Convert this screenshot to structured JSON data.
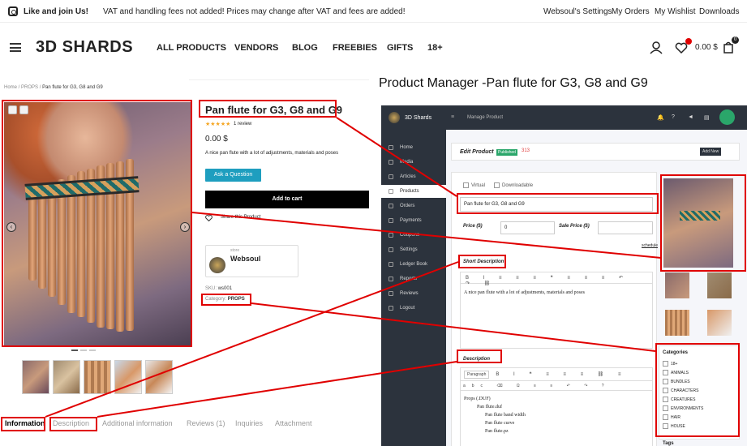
{
  "topbar": {
    "like": "Like and join Us!",
    "vat": "VAT and handling fees not added! Prices may change after VAT and fees are added!",
    "links": [
      "Websoul's Settings",
      "My Orders",
      "My Wishlist",
      "Downloads"
    ]
  },
  "nav": {
    "logo": "3D SHARDS",
    "items": [
      "ALL PRODUCTS",
      "VENDORS",
      "BLOG",
      "FREEBIES",
      "GIFTS",
      "18+"
    ],
    "cart_total": "0.00 $",
    "cart_count": "0"
  },
  "breadcrumb": {
    "home": "Home",
    "cat": "PROPS",
    "current": "Pan flute for G3, G8 and G9"
  },
  "product": {
    "title": "Pan flute for G3, G8 and G9",
    "stars": "★★★★★",
    "reviews": "1 review",
    "price": "0.00 $",
    "short_desc": "A nice pan flute with a lot of adjustments, materials and poses",
    "ask_btn": "Ask a Question",
    "cart_btn": "Add to cart",
    "share": "Share this Product",
    "store_label": "store",
    "store_name": "Websoul",
    "sku_label": "SKU:",
    "sku": "ws001",
    "cat_label": "Category:",
    "cat": "PROPS"
  },
  "tabs": [
    "Information",
    "Description",
    "Additional information",
    "Reviews (1)",
    "Inquiries",
    "Attachment"
  ],
  "manager_title": "Product Manager -Pan flute for G3, G8 and G9",
  "admin": {
    "brand": "3D Shards",
    "crumb": "Manage Product",
    "menu": [
      "Home",
      "Media",
      "Articles",
      "Products",
      "Orders",
      "Payments",
      "Coupons",
      "Settings",
      "Ledger Book",
      "Reports",
      "Reviews",
      "Logout"
    ],
    "edit_title": "Edit Product",
    "status": "Published",
    "views": "313",
    "add_new": "Add New",
    "virtual": "Virtual",
    "downloadable": "Downloadable",
    "name_value": "Pan flute for G3, G8 and G9",
    "price_label": "Price ($)",
    "sale_label": "Sale Price ($)",
    "price_value": "0",
    "schedule": "schedule",
    "short_desc_label": "Short Description",
    "short_desc_value": "A nice pan flute with a lot of adjustments, materials and poses",
    "desc_label": "Description",
    "paragraph": "Paragraph",
    "desc_lines": [
      "Props (.DUF)",
      "Pan flute.duf",
      "Pan flute band width",
      "Pan flute curve",
      "Pan flute.pz"
    ],
    "categories_label": "Categories",
    "categories": [
      "18+",
      "ANIMALS",
      "BUNDLES",
      "CHARACTERS",
      "CREATURES",
      "ENVIRONMENTS",
      "HAIR",
      "HOUSE"
    ],
    "tags_label": "Tags"
  }
}
